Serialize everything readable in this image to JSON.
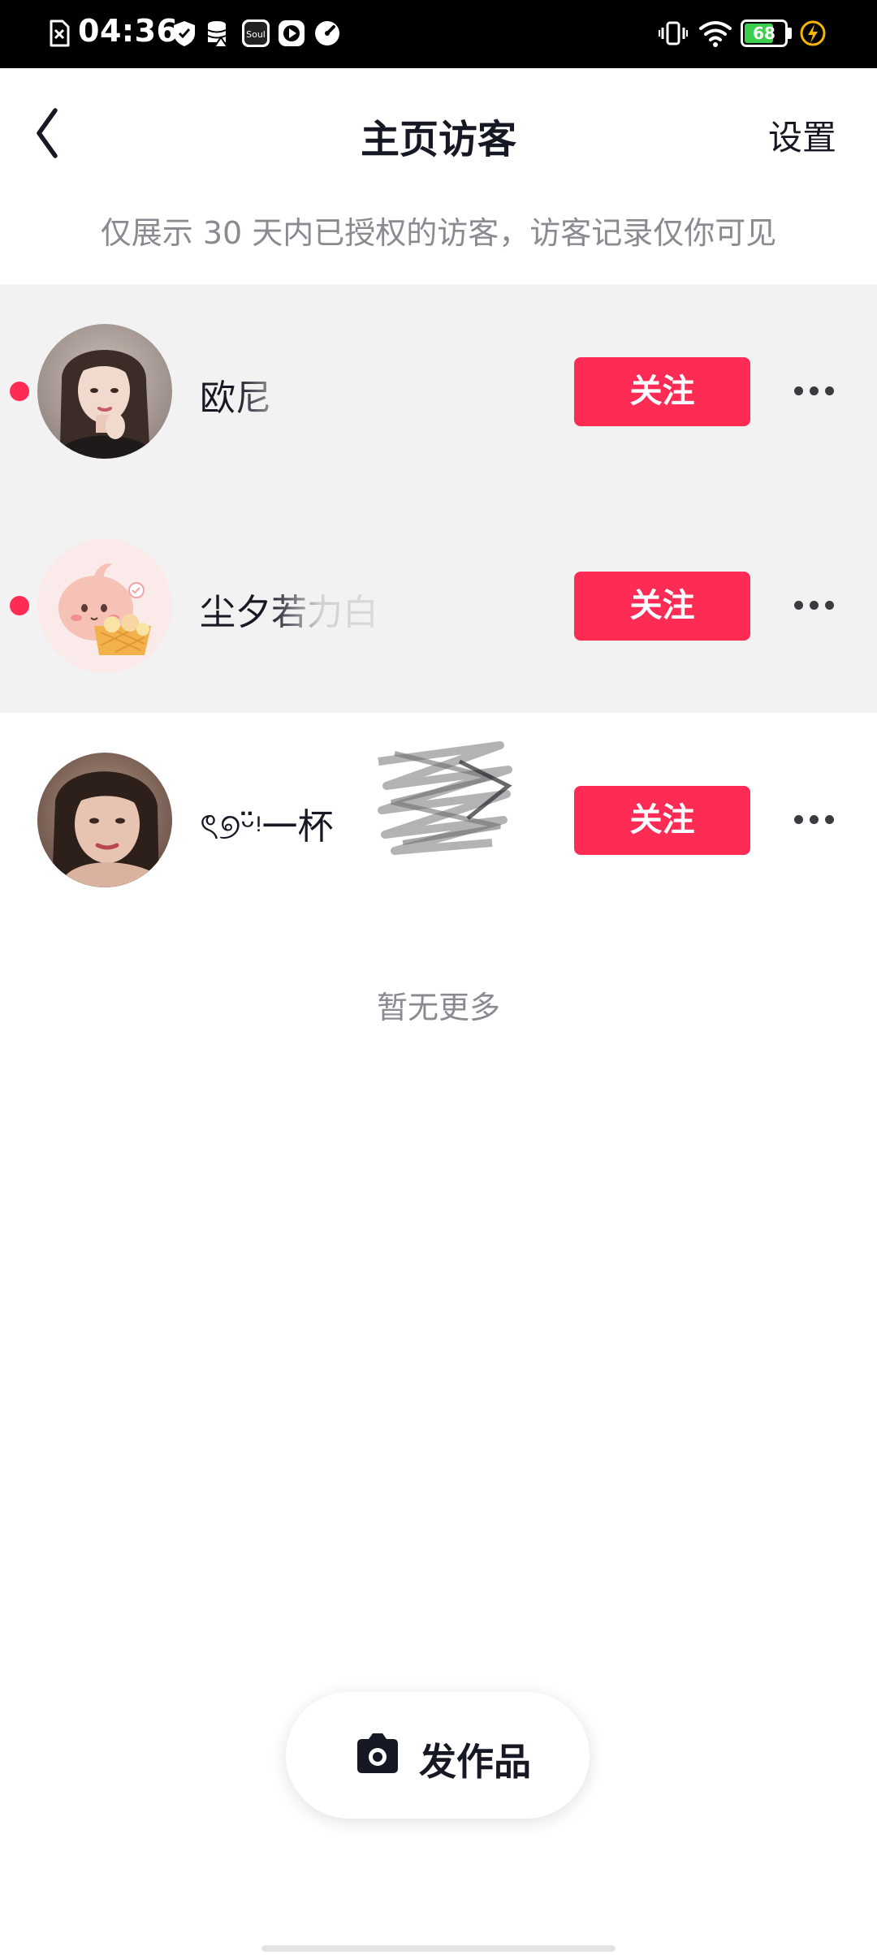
{
  "status_bar": {
    "time": "04:36",
    "battery_level": "68",
    "battery_fraction": 0.68,
    "icons": [
      "sim-error-icon",
      "shield-icon",
      "database-icon",
      "soul-app-icon",
      "play-icon",
      "speed-icon",
      "vibrate-icon",
      "wifi-icon",
      "battery-icon",
      "charging-icon"
    ],
    "left_icon_labels": {
      "soul": "Soul"
    }
  },
  "header": {
    "back_icon": "chevron-left-icon",
    "title": "主页访客",
    "settings_label": "设置"
  },
  "notice": "仅展示 30 天内已授权的访客，访客记录仅你可见",
  "visitors": [
    {
      "name": "欧尼",
      "unread": true,
      "follow_label": "关注"
    },
    {
      "name": "尘夕若力白",
      "unread": true,
      "follow_label": "关注"
    },
    {
      "name": "ৎ୭ᵕ̈ᵎ一杯",
      "unread": false,
      "follow_label": "关注"
    }
  ],
  "end_text": "暂无更多",
  "post_button": {
    "label": "发作品",
    "icon": "camera-icon"
  },
  "colors": {
    "accent": "#fe2c55",
    "unread_bg": "#f2f2f3",
    "text_primary": "#161823",
    "text_secondary": "#8a8b91"
  }
}
